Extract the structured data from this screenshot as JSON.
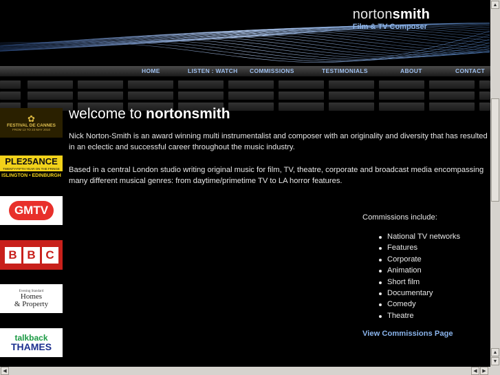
{
  "brand": {
    "name_regular": "norton",
    "name_bold": "smith",
    "tagline": "Film & TV Composer"
  },
  "nav": {
    "items": [
      "HOME",
      "LISTEN : WATCH",
      "COMMISSIONS",
      "TESTIMONIALS",
      "ABOUT",
      "CONTACT"
    ]
  },
  "logos": {
    "cannes": {
      "line1": "FESTIVAL DE CANNES",
      "line2": "FROM 13 TO 23 MAY 2010"
    },
    "pleasance": {
      "line1": "PLE25ANCE",
      "line2": "TWENTY-FIFTH YEAR ON THE FRINGE",
      "line3": "ISLINGTON • EDINBURGH"
    },
    "gmtv": "GMTV",
    "bbc": [
      "B",
      "B",
      "C"
    ],
    "homes": {
      "line1": "Homes",
      "line2": "& Property",
      "line3": "Evening Standard"
    },
    "talkback": {
      "line1": "talkback",
      "line2": "THAMES"
    }
  },
  "main": {
    "welcome_prefix": "welcome to ",
    "welcome_bold": "nortonsmith",
    "para1": "Nick Norton-Smith is an award winning multi instrumentalist and composer with an originality and diversity that has resulted in an eclectic and successful career throughout the music industry.",
    "para2": "Based in a central London studio writing original music for film, TV, theatre, corporate and broadcast media encompassing many different musical genres: from daytime/primetime TV to LA horror features."
  },
  "commissions": {
    "heading": "Commissions include:",
    "items": [
      "National TV networks",
      "Features",
      "Corporate",
      "Animation",
      "Short film",
      "Documentary",
      "Comedy",
      "Theatre"
    ],
    "link": "View Commissions Page"
  },
  "colors": {
    "background": "#000000",
    "nav_link": "#9fc0ef",
    "accent_blue": "#8ab4ec",
    "text": "#e8e8e8"
  }
}
